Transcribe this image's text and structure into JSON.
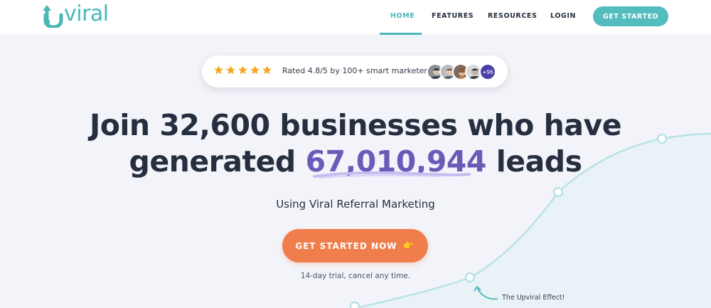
{
  "header": {
    "logo_text": "viral",
    "nav": [
      {
        "label": "HOME",
        "active": true
      },
      {
        "label": "FEATURES",
        "active": false
      },
      {
        "label": "RESOURCES",
        "active": false
      },
      {
        "label": "LOGIN",
        "active": false
      }
    ],
    "cta_label": "GET STARTED"
  },
  "rating": {
    "stars": 5,
    "text": "Rated 4.8/5 by 100+ smart marketers",
    "more_count": "+96"
  },
  "hero": {
    "line1": "Join 32,600 businesses who have",
    "line2_prefix": "generated",
    "highlight": "67,010,944",
    "line2_suffix": "leads",
    "subhead": "Using Viral Referral Marketing",
    "cta_label": "GET STARTED NOW",
    "cta_emoji": "👉",
    "trial_note": "14-day trial, cancel any time.",
    "effect_label": "The Upviral Effect!"
  },
  "colors": {
    "brand_teal": "#4ab8b8",
    "cta_orange": "#f07e4d",
    "highlight_purple": "#6b5bb8",
    "star_gold": "#f5a623",
    "text_dark": "#262f3f"
  }
}
